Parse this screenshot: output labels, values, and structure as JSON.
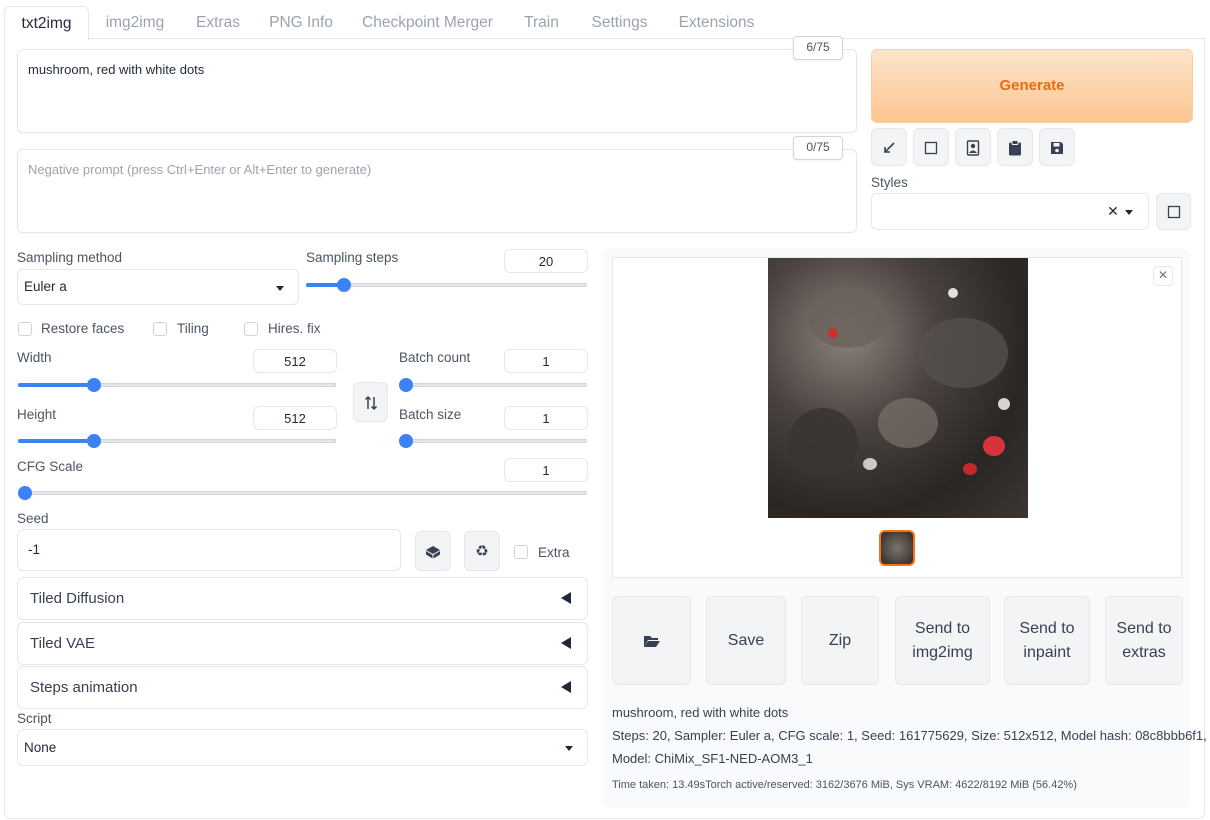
{
  "tabs": [
    "txt2img",
    "img2img",
    "Extras",
    "PNG Info",
    "Checkpoint Merger",
    "Train",
    "Settings",
    "Extensions"
  ],
  "prompt": {
    "value": "mushroom, red with white dots",
    "counter": "6/75"
  },
  "negative_prompt": {
    "placeholder": "Negative prompt (press Ctrl+Enter or Alt+Enter to generate)",
    "counter": "0/75"
  },
  "generate_label": "Generate",
  "tool_icons": [
    "arrow-icon",
    "trash-icon",
    "picture-icon",
    "clipboard-icon",
    "save-icon"
  ],
  "styles": {
    "label": "Styles"
  },
  "sampling": {
    "method_label": "Sampling method",
    "method_value": "Euler a",
    "steps_label": "Sampling steps",
    "steps_value": "20",
    "steps_fraction": 0.137
  },
  "checkboxes": {
    "restore_faces": "Restore faces",
    "tiling": "Tiling",
    "hires_fix": "Hires. fix"
  },
  "width": {
    "label": "Width",
    "value": "512",
    "fraction": 0.24
  },
  "height": {
    "label": "Height",
    "value": "512",
    "fraction": 0.24
  },
  "batch_count": {
    "label": "Batch count",
    "value": "1",
    "fraction": 0
  },
  "batch_size": {
    "label": "Batch size",
    "value": "1",
    "fraction": 0
  },
  "cfg": {
    "label": "CFG Scale",
    "value": "1",
    "fraction": 0
  },
  "seed": {
    "label": "Seed",
    "value": "-1",
    "extra": "Extra"
  },
  "accordions": [
    "Tiled Diffusion",
    "Tiled VAE",
    "Steps animation"
  ],
  "script": {
    "label": "Script",
    "value": "None"
  },
  "output_buttons": {
    "folder_icon": "folder-icon",
    "save": "Save",
    "zip": "Zip",
    "send_img2img": "Send to img2img",
    "send_inpaint": "Send to inpaint",
    "send_extras": "Send to extras"
  },
  "info": {
    "line1": "mushroom, red with white dots",
    "line2": "Steps: 20, Sampler: Euler a, CFG scale: 1, Seed: 161775629, Size: 512x512, Model hash: 08c8bbb6f1,",
    "line3": "Model: ChiMix_SF1-NED-AOM3_1",
    "line4": "Time taken: 13.49sTorch active/reserved: 3162/3676 MiB, Sys VRAM: 4622/8192 MiB (56.42%)"
  },
  "colors": {
    "accent": "#3b82f6",
    "generate": "#ea6b12"
  }
}
